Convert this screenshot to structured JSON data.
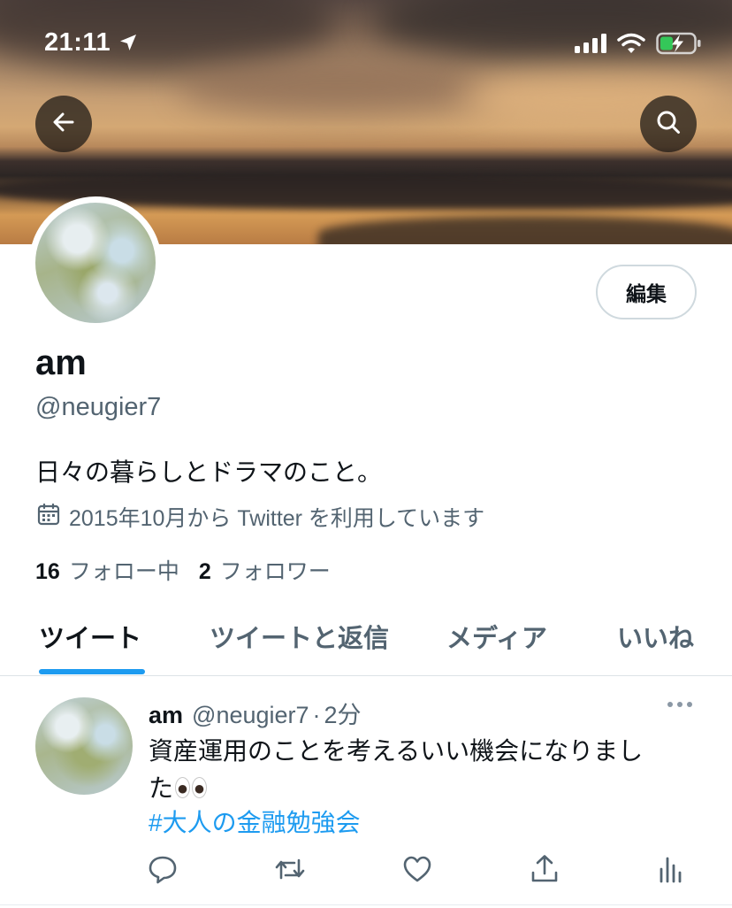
{
  "status_bar": {
    "time": "21:11"
  },
  "header": {
    "back_icon": "arrow-left-icon",
    "search_icon": "search-icon"
  },
  "profile": {
    "display_name": "am",
    "handle": "@neugier7",
    "bio": "日々の暮らしとドラマのこと。",
    "joined": "2015年10月から Twitter を利用しています",
    "edit_label": "編集",
    "following_count": "16",
    "following_label": "フォロー中",
    "followers_count": "2",
    "followers_label": "フォロワー"
  },
  "tabs": [
    {
      "label": "ツイート",
      "active": true
    },
    {
      "label": "ツイートと返信",
      "active": false
    },
    {
      "label": "メディア",
      "active": false
    },
    {
      "label": "いいね",
      "active": false
    }
  ],
  "tweet": {
    "name": "am",
    "handle": "@neugier7",
    "separator": "·",
    "time": "2分",
    "text_line1": "資産運用のことを考えるいい機会になりまし",
    "text_line2": "た",
    "emoji": "eyes",
    "hashtag": "#大人の金融勉強会",
    "actions": [
      "reply-icon",
      "retweet-icon",
      "like-icon",
      "share-icon",
      "analytics-icon"
    ]
  },
  "colors": {
    "accent": "#1d9bf0",
    "text_primary": "#0f1419",
    "text_secondary": "#536471"
  }
}
